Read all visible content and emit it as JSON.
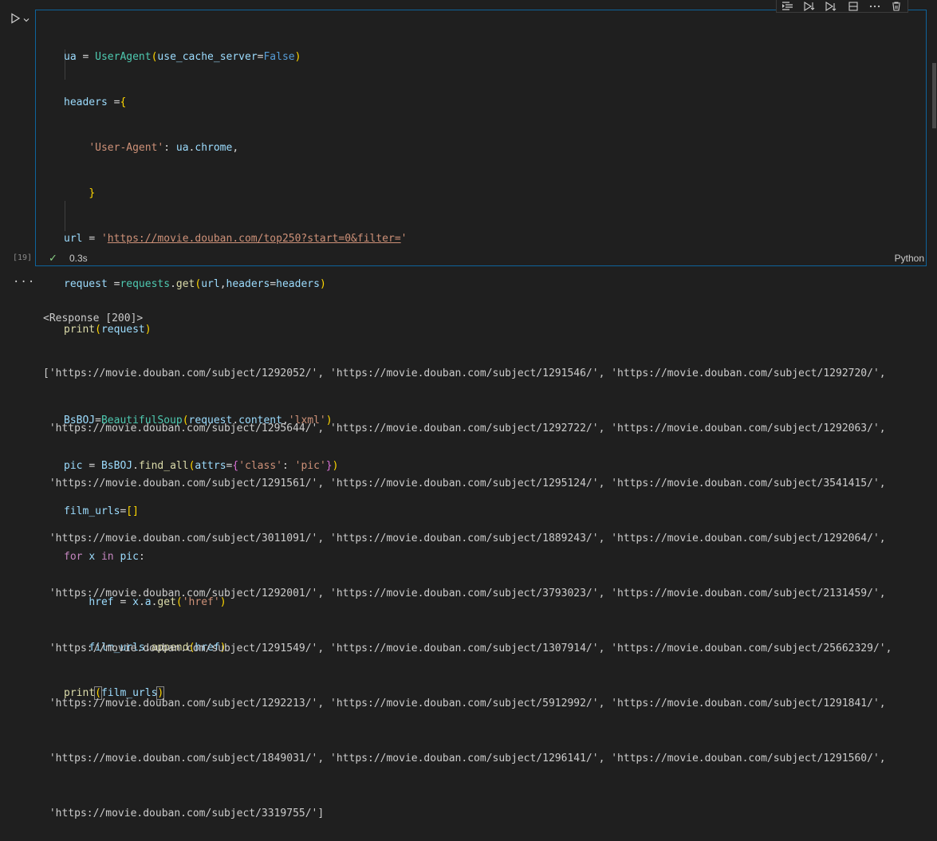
{
  "cell": {
    "execution_count": "[19]",
    "status_time": "0.3s",
    "language": "Python"
  },
  "toolbar": {
    "icons": [
      "run-by-line-icon",
      "execute-above-icon",
      "execute-below-icon",
      "split-cell-icon",
      "more-icon",
      "delete-icon"
    ]
  },
  "code_lines": [
    "ua = UserAgent(use_cache_server=False)",
    "headers ={",
    "    'User-Agent': ua.chrome,",
    "    }",
    "url = 'https://movie.douban.com/top250?start=0&filter='",
    "request =requests.get(url,headers=headers)",
    "print(request)",
    "",
    "BsBOJ=BeautifulSoup(request.content,'lxml')",
    "pic = BsBOJ.find_all(attrs={'class': 'pic'})",
    "film_urls=[]",
    "for x in pic:",
    "    href = x.a.get('href')",
    "    film_urls.append(href)",
    "print(film_urls)"
  ],
  "output": {
    "more": "...",
    "lines": [
      "<Response [200]>",
      "['https://movie.douban.com/subject/1292052/', 'https://movie.douban.com/subject/1291546/', 'https://movie.douban.com/subject/1292720/',",
      " 'https://movie.douban.com/subject/1295644/', 'https://movie.douban.com/subject/1292722/', 'https://movie.douban.com/subject/1292063/',",
      " 'https://movie.douban.com/subject/1291561/', 'https://movie.douban.com/subject/1295124/', 'https://movie.douban.com/subject/3541415/',",
      " 'https://movie.douban.com/subject/3011091/', 'https://movie.douban.com/subject/1889243/', 'https://movie.douban.com/subject/1292064/',",
      " 'https://movie.douban.com/subject/1292001/', 'https://movie.douban.com/subject/3793023/', 'https://movie.douban.com/subject/2131459/',",
      " 'https://movie.douban.com/subject/1291549/', 'https://movie.douban.com/subject/1307914/', 'https://movie.douban.com/subject/25662329/',",
      " 'https://movie.douban.com/subject/1292213/', 'https://movie.douban.com/subject/5912992/', 'https://movie.douban.com/subject/1291841/',",
      " 'https://movie.douban.com/subject/1849031/', 'https://movie.douban.com/subject/1296141/', 'https://movie.douban.com/subject/1291560/',",
      " 'https://movie.douban.com/subject/3319755/']"
    ]
  },
  "colors": {
    "accent_border": "#0e639c",
    "success_check": "#89d185",
    "background": "#1f1f1f"
  }
}
